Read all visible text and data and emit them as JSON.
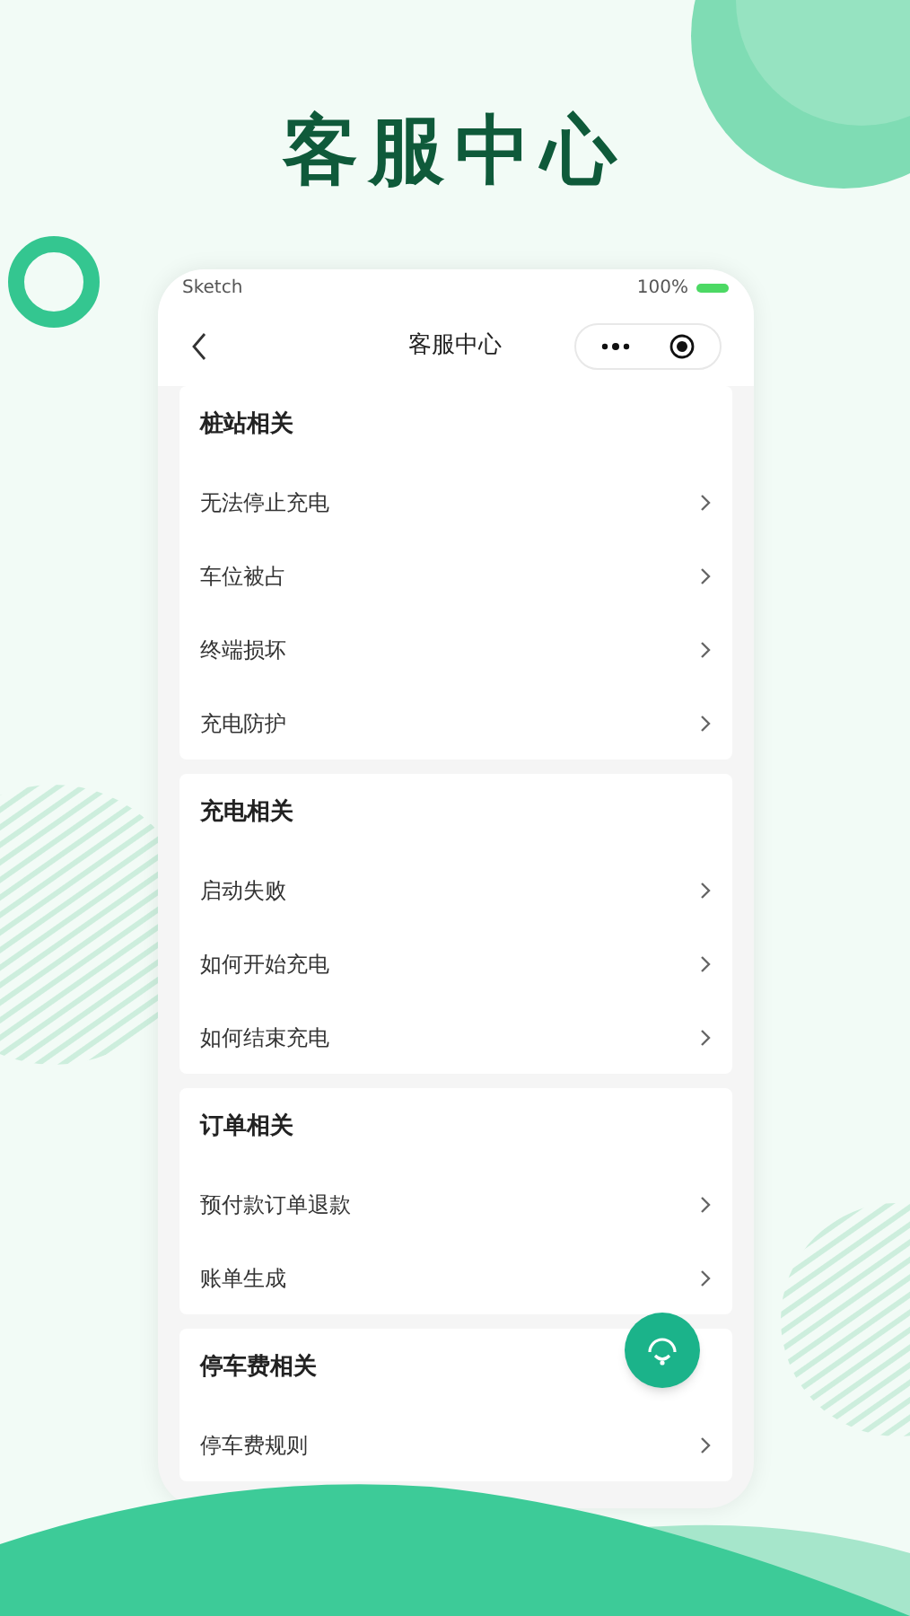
{
  "headline": "客服中心",
  "phone": {
    "status_bar": {
      "carrier": "Sketch",
      "battery": "100%"
    },
    "nav": {
      "title": "客服中心"
    },
    "sections": [
      {
        "title": "桩站相关",
        "items": [
          "无法停止充电",
          "车位被占",
          "终端损坏",
          "充电防护"
        ]
      },
      {
        "title": "充电相关",
        "items": [
          "启动失败",
          "如何开始充电",
          "如何结束充电"
        ]
      },
      {
        "title": "订单相关",
        "items": [
          "预付款订单退款",
          "账单生成"
        ]
      },
      {
        "title": "停车费相关",
        "items": [
          "停车费规则"
        ]
      }
    ]
  }
}
